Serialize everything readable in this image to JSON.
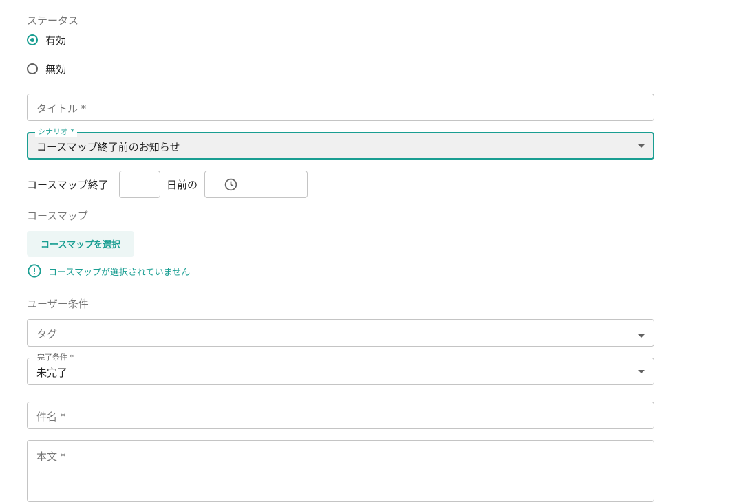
{
  "status": {
    "label": "ステータス",
    "options": [
      {
        "label": "有効",
        "checked": true
      },
      {
        "label": "無効",
        "checked": false
      }
    ]
  },
  "title_field": {
    "placeholder": "タイトル *"
  },
  "scenario_field": {
    "label": "シナリオ *",
    "value": "コースマップ終了前のお知らせ"
  },
  "timing": {
    "prefix": "コースマップ終了",
    "days_value": "",
    "middle": "日前の",
    "time_icon": "clock-icon"
  },
  "coursemap": {
    "label": "コースマップ",
    "select_button": "コースマップを選択",
    "warning_icon": "alert-circle-icon",
    "warning": "コースマップが選択されていません"
  },
  "user_conditions": {
    "label": "ユーザー条件",
    "tag_field": {
      "placeholder": "タグ"
    },
    "completion_field": {
      "label": "完了条件 *",
      "value": "未完了"
    }
  },
  "subject_field": {
    "placeholder": "件名 *"
  },
  "body_field": {
    "placeholder": "本文 *"
  },
  "colors": {
    "accent": "#1a9e92",
    "border": "#c4c4c4",
    "muted": "#757575"
  }
}
